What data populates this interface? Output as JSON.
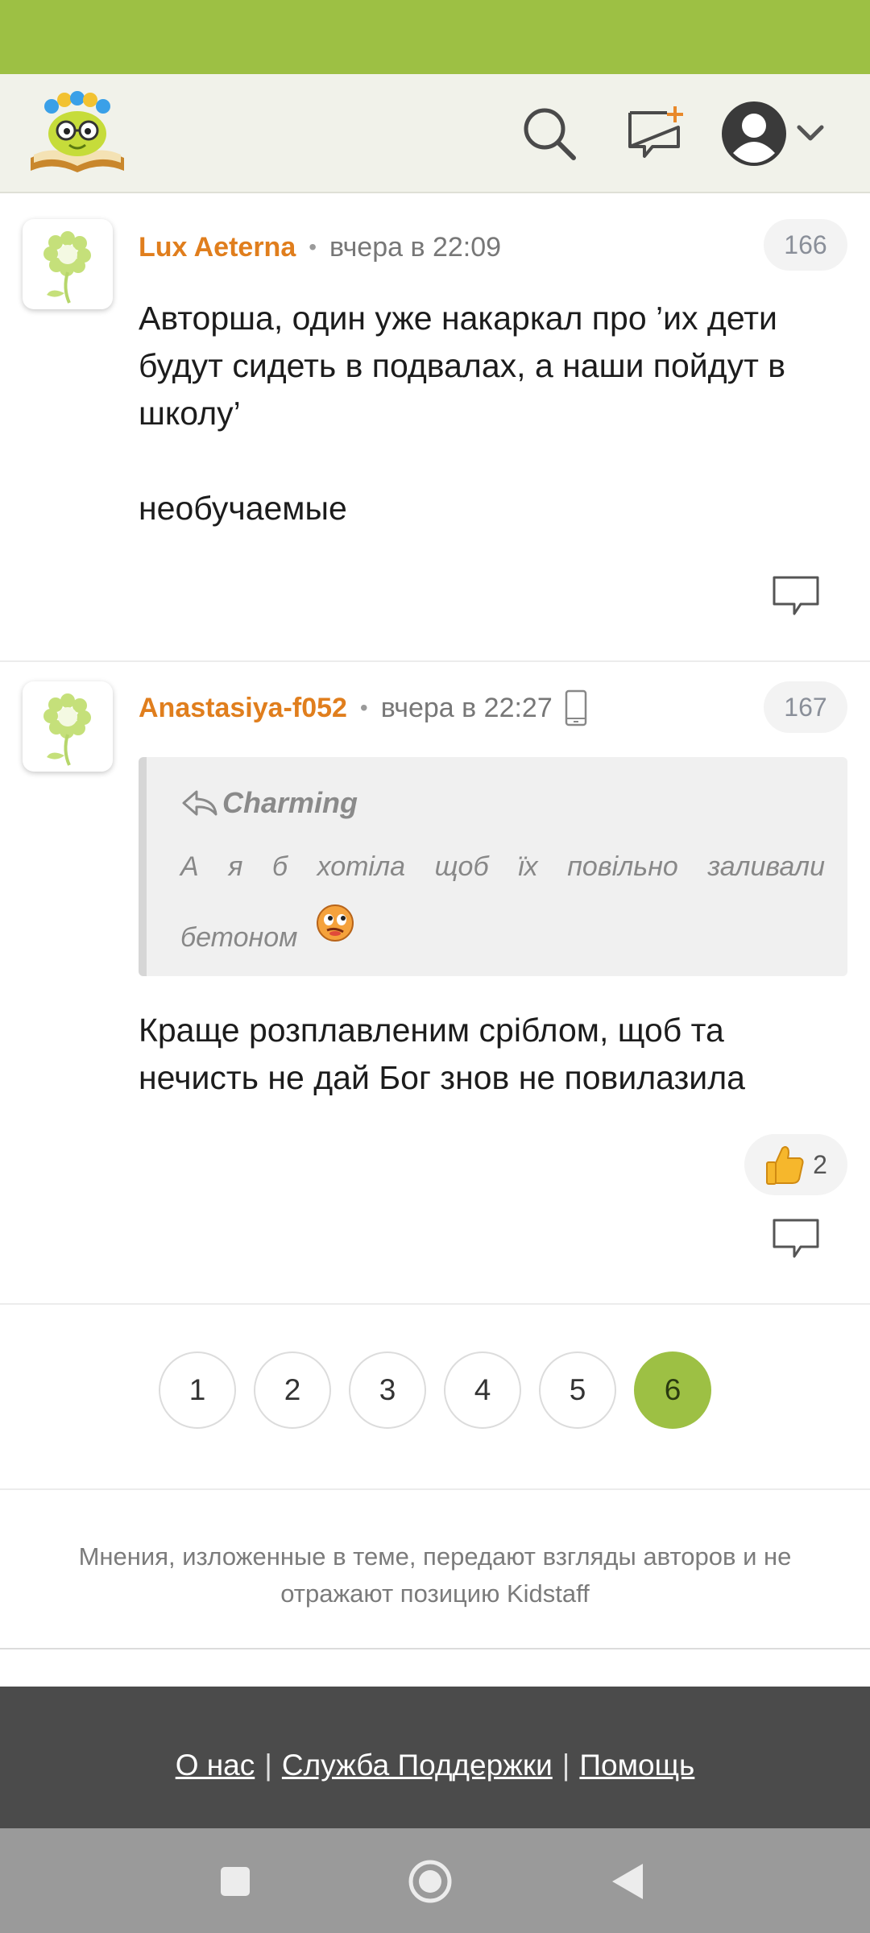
{
  "header": {
    "logo_icon": "kidstaff-logo-icon",
    "search_icon": "search-icon",
    "new_message_icon": "new-message-icon",
    "profile_icon": "user-avatar-icon",
    "dropdown_icon": "chevron-down-icon"
  },
  "comments": [
    {
      "author": "Lux Aeterna",
      "separator": "•",
      "time": "вчера в 22:09",
      "number": "166",
      "text": "Авторша, один уже накаркал про ’их дети будут сидеть в подвалах, а наши пойдут в школу’\n\nнеобучаемые"
    },
    {
      "author": "Anastasiya-f052",
      "separator": "•",
      "time": "вчера в 22:27",
      "number": "167",
      "quote_author": "Charming",
      "quote_text": "А я б хотіла щоб їх повільно заливали бетоном",
      "text": "Краще розплавленим сріблом, щоб та нечисть не дай Бог знов не повилазила",
      "likes": "2"
    }
  ],
  "pagination": {
    "pages": [
      "1",
      "2",
      "3",
      "4",
      "5",
      "6"
    ],
    "current": "6"
  },
  "disclaimer": "Мнения, изложенные в теме, передают взгляды авторов и не отражают позицию Kidstaff",
  "footer": {
    "links": [
      "О нас",
      "Служба Поддержки",
      "Помощь"
    ],
    "separator": "|"
  },
  "colors": {
    "accent_green": "#9dc044",
    "author_orange": "#e07e1d",
    "footer_dark": "#4b4b4b"
  }
}
